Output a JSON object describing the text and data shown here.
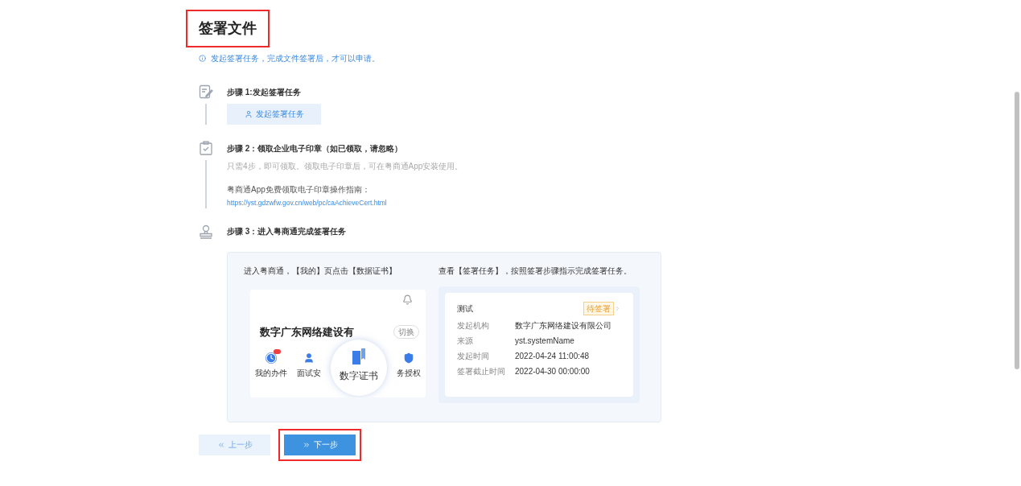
{
  "title": {
    "text": "签署文件",
    "highlighted": true
  },
  "notice": "发起签署任务，完成文件签署后，才可以申请。",
  "steps": [
    {
      "kind": "action",
      "title": "步骤 1:发起签署任务",
      "button": "发起签署任务"
    },
    {
      "kind": "guide",
      "title": "步骤 2：领取企业电子印章（如已领取，请忽略）",
      "hint": "只需4步，即可领取。领取电子印章后，可在粤商通App安装使用。",
      "guide_label": "粤商通App免费领取电子印章操作指南：",
      "link": "https://yst.gdzwfw.gov.cn/web/pc/caAchieveCert.html"
    },
    {
      "kind": "demo",
      "title": "步骤 3：进入粤商通完成签署任务"
    }
  ],
  "demo": {
    "left_caption": "进入粤商通，【我的】页点击【数据证书】",
    "company": "数字广东网络建设有",
    "switch": "切换",
    "apps": [
      {
        "label": "我的办件",
        "badge": true
      },
      {
        "label": "面试安",
        "badge": false
      },
      {
        "label": "务授权",
        "badge": false
      }
    ],
    "magnified": "数字证书",
    "right_caption": "查看【签署任务】，按照签署步骤指示完成签署任务。",
    "task": {
      "name": "测试",
      "status": "待签署",
      "fields": [
        {
          "label": "发起机构",
          "value": "数字广东网络建设有限公司"
        },
        {
          "label": "来源",
          "value": "yst.systemName"
        },
        {
          "label": "发起时间",
          "value": "2022-04-24 11:00:48"
        },
        {
          "label": "签署截止时间",
          "value": "2022-04-30 00:00:00"
        }
      ]
    }
  },
  "buttons": [
    {
      "kind": "prev",
      "label": "上一步",
      "highlighted": false
    },
    {
      "kind": "next",
      "label": "下一步",
      "highlighted": true
    }
  ]
}
